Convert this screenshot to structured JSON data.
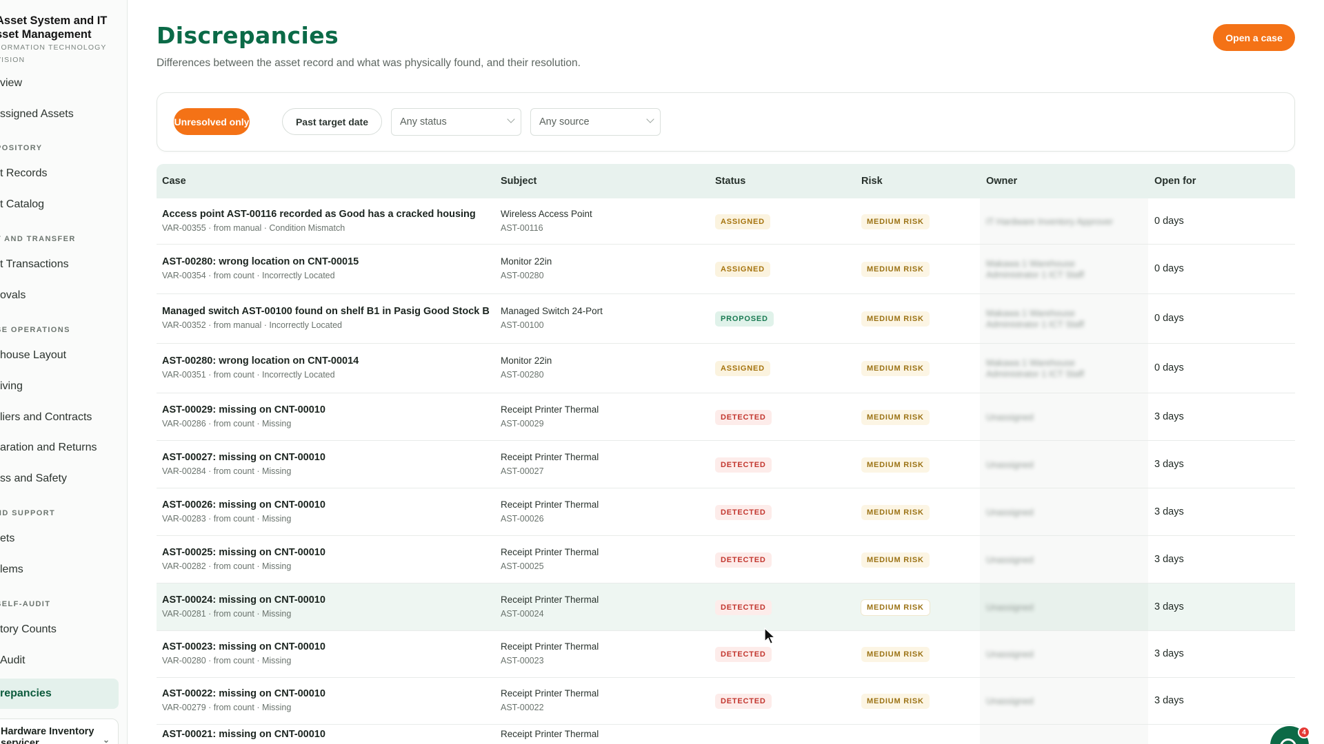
{
  "sidebar": {
    "brand_title_1": "Asset System and IT",
    "brand_title_2": "sset Management",
    "brand_sub_1": "FORMATION TECHNOLOGY",
    "brand_sub_2": "VISION",
    "items": [
      {
        "label": "view"
      },
      {
        "label": "ssigned Assets"
      },
      {
        "label": "t Records"
      },
      {
        "label": "t Catalog"
      },
      {
        "label": "t Transactions"
      },
      {
        "label": "ovals"
      },
      {
        "label": "house Layout"
      },
      {
        "label": "iving"
      },
      {
        "label": "liers and Contracts"
      },
      {
        "label": "aration and Returns"
      },
      {
        "label": "ss and Safety"
      },
      {
        "label": "ets"
      },
      {
        "label": "lems"
      },
      {
        "label": "tory Counts"
      },
      {
        "label": "Audit"
      },
      {
        "label": "repancies"
      }
    ],
    "sections": [
      "POSITORY",
      "T AND TRANSFER",
      "SE OPERATIONS",
      "ND SUPPORT",
      "SELF-AUDIT"
    ],
    "org_line_1": "Hardware Inventory",
    "org_line_2": "servicer"
  },
  "header": {
    "title": "Discrepancies",
    "subtitle": "Differences between the asset record and what was physically found, and their resolution.",
    "open_case": "Open a case"
  },
  "filters": {
    "unresolved": "Unresolved only",
    "past_target": "Past target date",
    "status_placeholder": "Any status",
    "source_placeholder": "Any source"
  },
  "table": {
    "columns": [
      "Case",
      "Subject",
      "Status",
      "Risk",
      "Owner",
      "Open for"
    ],
    "rows": [
      {
        "title": "Access point AST-00116 recorded as Good has a cracked housing",
        "meta": "VAR-00355 · from manual · Condition Mismatch",
        "subject": "Wireless Access Point",
        "asset": "AST-00116",
        "status": "ASSIGNED",
        "risk": "MEDIUM RISK",
        "owner": "IT Hardware Inventory Approver",
        "open_for": "0 days"
      },
      {
        "title": "AST-00280: wrong location on CNT-00015",
        "meta": "VAR-00354 · from count · Incorrectly Located",
        "subject": "Monitor 22in",
        "asset": "AST-00280",
        "status": "ASSIGNED",
        "risk": "MEDIUM RISK",
        "owner": "Makawa 1 Warehouse Administrator 1 ICT Staff",
        "open_for": "0 days"
      },
      {
        "title": "Managed switch AST-00100 found on shelf B1 in Pasig Good Stock B",
        "meta": "VAR-00352 · from manual · Incorrectly Located",
        "subject": "Managed Switch 24-Port",
        "asset": "AST-00100",
        "status": "PROPOSED",
        "risk": "MEDIUM RISK",
        "owner": "Makawa 1 Warehouse Administrator 1 ICT Staff",
        "open_for": "0 days"
      },
      {
        "title": "AST-00280: wrong location on CNT-00014",
        "meta": "VAR-00351 · from count · Incorrectly Located",
        "subject": "Monitor 22in",
        "asset": "AST-00280",
        "status": "ASSIGNED",
        "risk": "MEDIUM RISK",
        "owner": "Makawa 1 Warehouse Administrator 1 ICT Staff",
        "open_for": "0 days"
      },
      {
        "title": "AST-00029: missing on CNT-00010",
        "meta": "VAR-00286 · from count · Missing",
        "subject": "Receipt Printer Thermal",
        "asset": "AST-00029",
        "status": "DETECTED",
        "risk": "MEDIUM RISK",
        "owner": "Unassigned",
        "open_for": "3 days"
      },
      {
        "title": "AST-00027: missing on CNT-00010",
        "meta": "VAR-00284 · from count · Missing",
        "subject": "Receipt Printer Thermal",
        "asset": "AST-00027",
        "status": "DETECTED",
        "risk": "MEDIUM RISK",
        "owner": "Unassigned",
        "open_for": "3 days"
      },
      {
        "title": "AST-00026: missing on CNT-00010",
        "meta": "VAR-00283 · from count · Missing",
        "subject": "Receipt Printer Thermal",
        "asset": "AST-00026",
        "status": "DETECTED",
        "risk": "MEDIUM RISK",
        "owner": "Unassigned",
        "open_for": "3 days"
      },
      {
        "title": "AST-00025: missing on CNT-00010",
        "meta": "VAR-00282 · from count · Missing",
        "subject": "Receipt Printer Thermal",
        "asset": "AST-00025",
        "status": "DETECTED",
        "risk": "MEDIUM RISK",
        "owner": "Unassigned",
        "open_for": "3 days"
      },
      {
        "title": "AST-00024: missing on CNT-00010",
        "meta": "VAR-00281 · from count · Missing",
        "subject": "Receipt Printer Thermal",
        "asset": "AST-00024",
        "status": "DETECTED",
        "risk": "MEDIUM RISK",
        "owner": "Unassigned",
        "open_for": "3 days"
      },
      {
        "title": "AST-00023: missing on CNT-00010",
        "meta": "VAR-00280 · from count · Missing",
        "subject": "Receipt Printer Thermal",
        "asset": "AST-00023",
        "status": "DETECTED",
        "risk": "MEDIUM RISK",
        "owner": "Unassigned",
        "open_for": "3 days"
      },
      {
        "title": "AST-00022: missing on CNT-00010",
        "meta": "VAR-00279 · from count · Missing",
        "subject": "Receipt Printer Thermal",
        "asset": "AST-00022",
        "status": "DETECTED",
        "risk": "MEDIUM RISK",
        "owner": "Unassigned",
        "open_for": "3 days"
      },
      {
        "title": "AST-00021: missing on CNT-00010",
        "meta": "",
        "subject": "Receipt Printer Thermal",
        "asset": "",
        "status": "",
        "risk": "",
        "owner": "",
        "open_for": ""
      }
    ]
  },
  "help": {
    "badge_count": "4"
  },
  "colors": {
    "brand_green": "#0b6a47",
    "accent_orange": "#f47216"
  }
}
